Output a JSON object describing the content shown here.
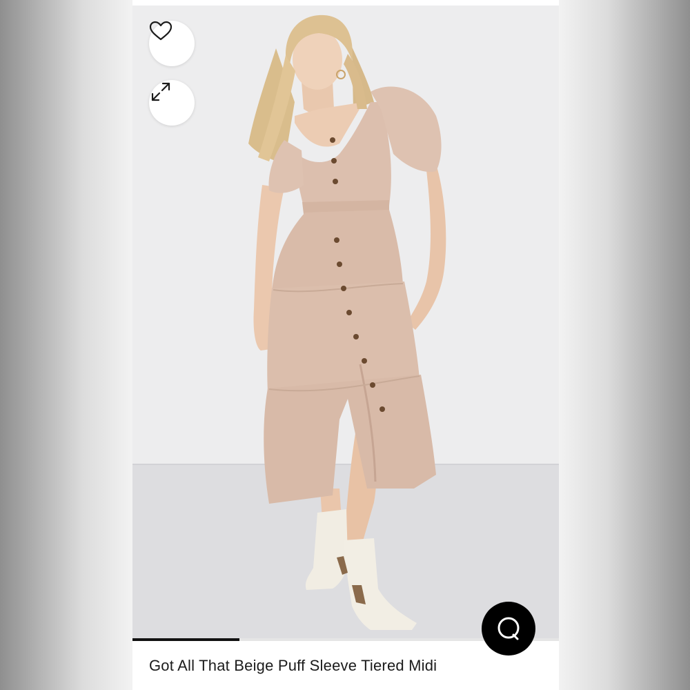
{
  "product": {
    "title": "Got All That Beige Puff Sleeve Tiered Midi"
  },
  "gallery": {
    "progress_fraction": 0.25,
    "image_subject": "model wearing beige puff sleeve tiered midi dress with white ankle boots"
  },
  "buttons": {
    "favorite_icon": "heart-icon",
    "expand_icon": "expand-arrows-icon",
    "chat_icon": "chat-bubble-icon"
  },
  "colors": {
    "dress": "#dcbfae",
    "accent": "#000000",
    "progress": "#111111"
  }
}
